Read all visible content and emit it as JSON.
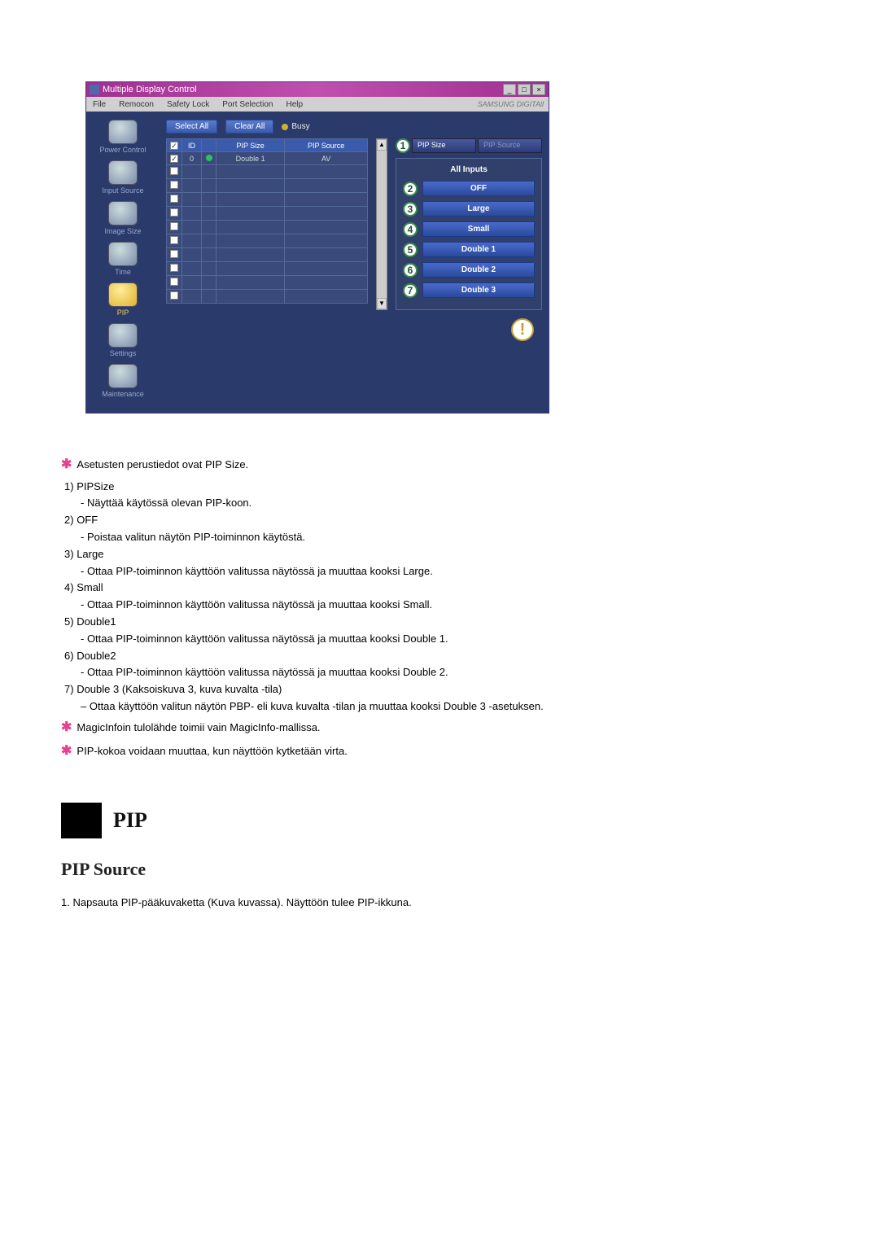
{
  "app": {
    "title": "Multiple Display Control",
    "brand": "SAMSUNG DIGITAll",
    "menu": [
      "File",
      "Remocon",
      "Safety Lock",
      "Port Selection",
      "Help"
    ],
    "top_buttons": {
      "select_all": "Select All",
      "clear_all": "Clear All",
      "busy": "Busy"
    },
    "sidebar": [
      {
        "label": "Power Control"
      },
      {
        "label": "Input Source"
      },
      {
        "label": "Image Size"
      },
      {
        "label": "Time"
      },
      {
        "label": "PIP",
        "active": true
      },
      {
        "label": "Settings"
      },
      {
        "label": "Maintenance"
      }
    ],
    "table": {
      "headers": [
        "",
        "ID",
        "",
        "PIP Size",
        "PIP Source"
      ],
      "rows": [
        {
          "checked": true,
          "id": "0",
          "status": true,
          "pip_size": "Double 1",
          "pip_source": "AV"
        },
        {
          "checked": false
        },
        {
          "checked": false
        },
        {
          "checked": false
        },
        {
          "checked": false
        },
        {
          "checked": false
        },
        {
          "checked": false
        },
        {
          "checked": false
        },
        {
          "checked": false
        },
        {
          "checked": false
        },
        {
          "checked": false
        }
      ]
    },
    "tabs": {
      "pip_size": "PIP Size",
      "pip_source": "PIP Source",
      "active_num": "1"
    },
    "panel": {
      "header": "All Inputs",
      "options": [
        {
          "num": "2",
          "label": "OFF"
        },
        {
          "num": "3",
          "label": "Large"
        },
        {
          "num": "4",
          "label": "Small"
        },
        {
          "num": "5",
          "label": "Double 1"
        },
        {
          "num": "6",
          "label": "Double 2"
        },
        {
          "num": "7",
          "label": "Double 3"
        }
      ]
    }
  },
  "text": {
    "intro": "Asetusten perustiedot ovat PIP Size.",
    "items": [
      {
        "n": "1)",
        "t": "PIPSize",
        "s": "- Näyttää käytössä olevan PIP-koon."
      },
      {
        "n": "2)",
        "t": "OFF",
        "s": "- Poistaa valitun näytön PIP-toiminnon käytöstä."
      },
      {
        "n": "3)",
        "t": "Large",
        "s": "- Ottaa PIP-toiminnon käyttöön valitussa näytössä ja muuttaa kooksi Large."
      },
      {
        "n": "4)",
        "t": "Small",
        "s": "- Ottaa PIP-toiminnon käyttöön valitussa näytössä ja muuttaa kooksi Small."
      },
      {
        "n": "5)",
        "t": "Double1",
        "s": "- Ottaa PIP-toiminnon käyttöön valitussa näytössä ja muuttaa kooksi Double 1."
      },
      {
        "n": "6)",
        "t": "Double2",
        "s": "- Ottaa PIP-toiminnon käyttöön valitussa näytössä ja muuttaa kooksi Double 2."
      },
      {
        "n": "7)",
        "t": "Double 3 (Kaksoiskuva 3, kuva kuvalta -tila)",
        "s": "– Ottaa käyttöön valitun näytön PBP- eli kuva kuvalta -tilan ja muuttaa kooksi Double 3 -asetuksen."
      }
    ],
    "note1": "MagicInfoin tulolähde toimii vain MagicInfo-mallissa.",
    "note2": "PIP-kokoa voidaan muuttaa, kun näyttöön kytketään virta.",
    "section_head": "PIP",
    "sub_head": "PIP Source",
    "para": "1. Napsauta PIP-pääkuvaketta (Kuva kuvassa). Näyttöön tulee PIP-ikkuna."
  }
}
